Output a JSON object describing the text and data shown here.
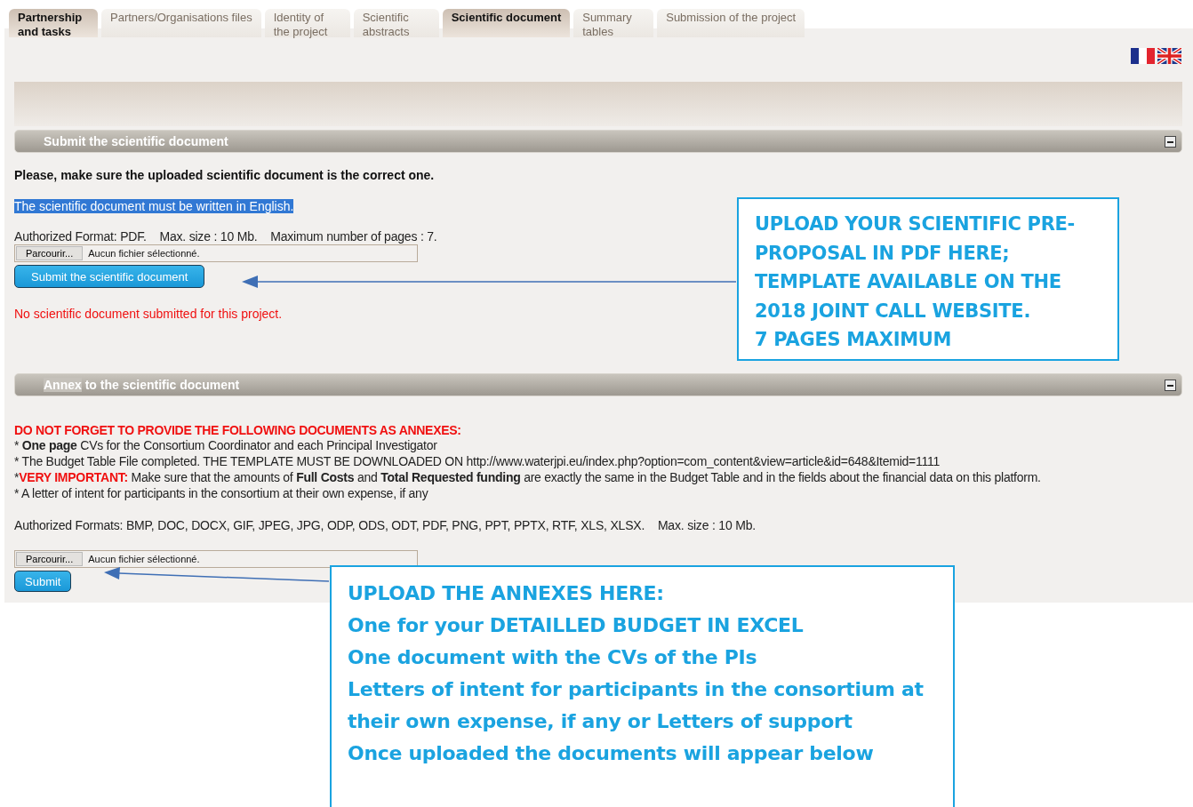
{
  "tabs": [
    {
      "label": "Partnership and tasks",
      "selected": true
    },
    {
      "label": "Partners/Organisations files",
      "selected": false
    },
    {
      "label": "Identity of the project",
      "selected": false
    },
    {
      "label": "Scientific abstracts",
      "selected": false
    },
    {
      "label": "Scientific document",
      "selected": true
    },
    {
      "label": "Summary tables",
      "selected": false
    },
    {
      "label": "Submission of the project",
      "selected": false
    }
  ],
  "document_section": {
    "title": [
      {
        "text": "Submit the scientific document",
        "highlighted": false
      }
    ],
    "notice": "Please, make sure the uploaded scientific document is the correct one.",
    "language_note": {
      "text": "The scientific document must be written in English.",
      "highlighted": true
    },
    "formats": "Authorized Format: PDF.    Max. size : 10 Mb.    Maximum number of pages : 7.",
    "file_input": {
      "button": "Parcourir...",
      "value": "Aucun fichier sélectionné."
    },
    "submit_button": "Submit the scientific document",
    "status": "No scientific document submitted for this project."
  },
  "annex_section": {
    "title": [
      {
        "text": "Annex",
        "highlighted": true
      },
      {
        "text": " to the scientific document",
        "highlighted": false
      }
    ],
    "warning": "DO NOT FORGET TO PROVIDE THE FOLLOWING DOCUMENTS AS ANNEXES:",
    "items": [
      {
        "segments": [
          {
            "kind": "plain",
            "text": "* **One page** CVs for the Consortium Coordinator and each Principal Investigator"
          }
        ]
      },
      {
        "segments": [
          {
            "kind": "plain",
            "text": "* The Budget Table File completed. THE TEMPLATE MUST BE DOWNLOADED ON http://www.waterjpi.eu/index.php?option=com_content&view=article&id=648&Itemid=1111"
          }
        ]
      },
      {
        "segments": [
          {
            "kind": "plain",
            "text": "*"
          },
          {
            "kind": "alert",
            "text": "VERY IMPORTANT:"
          },
          {
            "kind": "plain",
            "text": " Make sure that the amounts of **Full Costs** and **Total Requested funding** are exactly the same in the Budget Table and in the fields about the financial data on this platform."
          }
        ]
      },
      {
        "segments": [
          {
            "kind": "plain",
            "text": "* A letter of intent for participants in the consortium at their own expense, if any"
          }
        ]
      }
    ],
    "formats": "Authorized Formats: BMP, DOC, DOCX, GIF, JPEG, JPG, ODP, ODS, ODT, PDF, PNG, PPT, PPTX, RTF, XLS, XLSX.    Max. size : 10 Mb.",
    "file_input": {
      "button": "Parcourir...",
      "value": "Aucun fichier sélectionné."
    },
    "submit_button": "Submit"
  },
  "callouts": [
    {
      "lines": [
        "UPLOAD YOUR SCIENTIFIC PRE-",
        "PROPOSAL IN PDF HERE;",
        "TEMPLATE AVAILABLE ON THE",
        "2018 JOINT CALL WEBSITE.",
        "7 PAGES MAXIMUM"
      ]
    },
    {
      "lines": [
        "UPLOAD THE ANNEXES HERE:",
        "One for your DETAILLED BUDGET IN EXCEL",
        "One document with the CVs of the PIs",
        "Letters of intent for participants in the consortium at",
        "their own expense, if any or Letters of support",
        "Once uploaded the documents will appear below"
      ]
    }
  ]
}
